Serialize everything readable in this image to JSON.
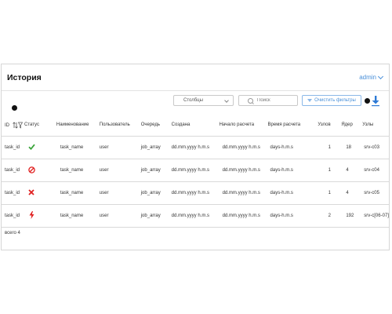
{
  "header": {
    "title": "История",
    "user": "admin"
  },
  "toolbar": {
    "columns_select": "Столбцы",
    "search_placeholder": "Поиск",
    "clear_filters_label": "Очистить фильтры"
  },
  "table": {
    "headers": {
      "id": "ID",
      "status": "Статус",
      "name": "Наименование",
      "user": "Пользователь",
      "queue": "Очередь",
      "created": "Создана",
      "start": "Начало расчета",
      "runtime": "Время расчета",
      "nodes": "Узлов",
      "cores": "Ядер",
      "hosts": "Узлы"
    },
    "rows": [
      {
        "id": "task_id",
        "status": "success",
        "name": "task_name",
        "user": "user",
        "queue": "job_array",
        "created": "dd.mm.yyyy h.m.s",
        "start": "dd.mm.yyyy h.m.s",
        "runtime": "days-h.m.s",
        "nodes": "1",
        "cores": "18",
        "hosts": "srv-c03"
      },
      {
        "id": "task_id",
        "status": "cancelled",
        "name": "task_name",
        "user": "user",
        "queue": "job_array",
        "created": "dd.mm.yyyy h.m.s",
        "start": "dd.mm.yyyy h.m.s",
        "runtime": "days-h.m.s",
        "nodes": "1",
        "cores": "4",
        "hosts": "srv-c04"
      },
      {
        "id": "task_id",
        "status": "failed",
        "name": "task_name",
        "user": "user",
        "queue": "job_array",
        "created": "dd.mm.yyyy h.m.s",
        "start": "dd.mm.yyyy h.m.s",
        "runtime": "days-h.m.s",
        "nodes": "1",
        "cores": "4",
        "hosts": "srv-c05"
      },
      {
        "id": "task_id",
        "status": "running",
        "name": "task_name",
        "user": "user",
        "queue": "job_array",
        "created": "dd.mm.yyyy h.m.s",
        "start": "dd.mm.yyyy h.m.s",
        "runtime": "days-h.m.s",
        "nodes": "2",
        "cores": "192",
        "hosts": "srv-c[06-07]"
      }
    ],
    "status_icons": {
      "success": "check-icon",
      "cancelled": "cancel-icon",
      "failed": "cross-icon",
      "running": "lightning-icon"
    },
    "status_colors": {
      "success": "#3aa43a",
      "cancelled": "#e02020",
      "failed": "#e02020",
      "running": "#e02020"
    }
  },
  "footer": {
    "total": "всего 4"
  },
  "colors": {
    "accent": "#4a90d9",
    "border": "#d9d9d9"
  }
}
